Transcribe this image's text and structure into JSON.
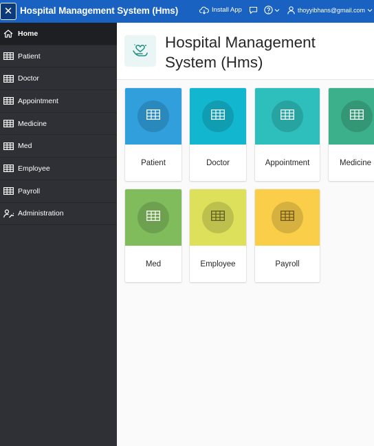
{
  "app": {
    "title": "Hospital Management System (Hms)",
    "toggle_icon": "close-icon"
  },
  "topbar": {
    "install_label": "Install App",
    "user_email": "thoyyibhans@gmail.com"
  },
  "sidebar": {
    "items": [
      {
        "label": "Home",
        "icon": "home-icon",
        "active": true
      },
      {
        "label": "Patient",
        "icon": "table-icon"
      },
      {
        "label": "Doctor",
        "icon": "table-icon"
      },
      {
        "label": "Appointment",
        "icon": "table-icon"
      },
      {
        "label": "Medicine",
        "icon": "table-icon"
      },
      {
        "label": "Med",
        "icon": "table-icon"
      },
      {
        "label": "Employee",
        "icon": "table-icon"
      },
      {
        "label": "Payroll",
        "icon": "table-icon"
      },
      {
        "label": "Administration",
        "icon": "user-wrench-icon"
      }
    ]
  },
  "page": {
    "title": "Hospital Management System (Hms)"
  },
  "cards": [
    {
      "label": "Patient",
      "color": "#309fdb"
    },
    {
      "label": "Doctor",
      "color": "#13b6cf"
    },
    {
      "label": "Appointment",
      "color": "#2ebfbc"
    },
    {
      "label": "Medicine",
      "color": "#3cb08a"
    },
    {
      "label": "Med",
      "color": "#80bc5c"
    },
    {
      "label": "Employee",
      "color": "#dde05a"
    },
    {
      "label": "Payroll",
      "color": "#fbce4a"
    }
  ],
  "colors": {
    "topbar": "#1a62c2",
    "sidebar": "#2e3035",
    "sidebar_active": "#1e1f22"
  }
}
